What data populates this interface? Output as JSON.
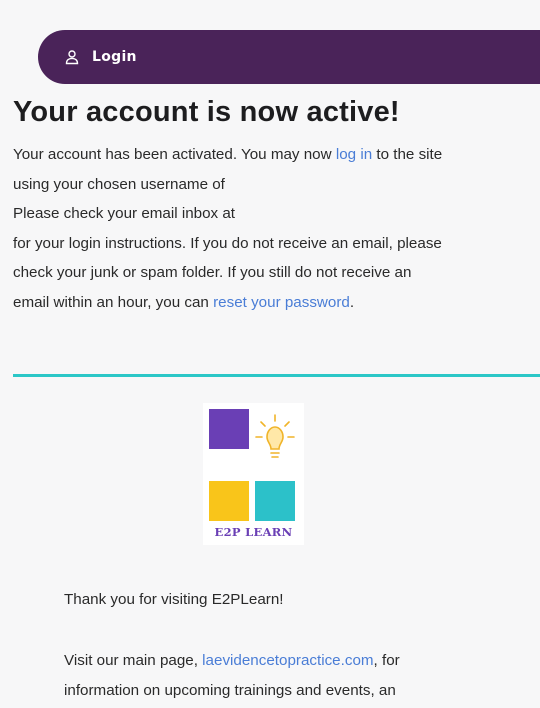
{
  "login_bar": {
    "label": "Login",
    "icon": "user-icon"
  },
  "activation": {
    "title": "Your account is now active!",
    "line1_prefix": "Your account has been activated. You may now ",
    "login_link": "log in",
    "line1_suffix": " to the site",
    "line2": "using your chosen username of",
    "line3": "Please check your email inbox at",
    "line4": "for your login instructions. If you do not receive an email, please",
    "line5": "check your junk or spam folder. If you still do not receive an",
    "line6_prefix": "email within an hour, you can ",
    "reset_link": "reset your password",
    "line6_suffix": "."
  },
  "logo": {
    "text": "E2P LEARN"
  },
  "footer": {
    "thanks": "Thank you for visiting E2PLearn!",
    "visit_prefix": "Visit our main page, ",
    "site_link": "laevidencetopractice.com",
    "visit_suffix": ", for",
    "visit_line2": "information on upcoming trainings and events, an"
  },
  "colors": {
    "login_bar": "#4a2359",
    "link": "#4a7dd6",
    "divider": "#2bc7c7",
    "logo_purple": "#6a3fb5",
    "logo_yellow": "#f9c51a",
    "logo_teal": "#2cc1c9"
  }
}
